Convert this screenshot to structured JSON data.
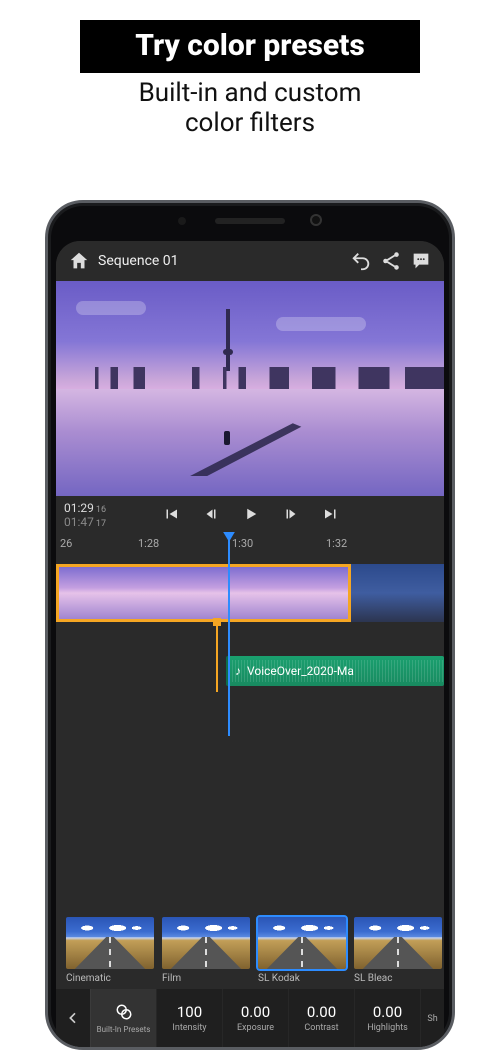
{
  "promo": {
    "title": "Try color presets",
    "subtitle_line1": "Built-in and custom",
    "subtitle_line2": "color filters"
  },
  "topbar": {
    "sequence_name": "Sequence 01"
  },
  "timecode": {
    "in": "01:29",
    "in_frames": "16",
    "out": "01:47",
    "out_frames": "17"
  },
  "ruler": {
    "labels": [
      "26",
      "1:28",
      "1:30",
      "1:32"
    ]
  },
  "audio_clip": {
    "label": "VoiceOver_2020-Ma"
  },
  "presets": [
    {
      "label": "Cinematic",
      "selected": false
    },
    {
      "label": "Film",
      "selected": false
    },
    {
      "label": "SL Kodak",
      "selected": true
    },
    {
      "label": "SL Bleac",
      "selected": false
    }
  ],
  "params": {
    "builtin_label": "Built-In Presets",
    "items": [
      {
        "value": "100",
        "label": "Intensity"
      },
      {
        "value": "0.00",
        "label": "Exposure"
      },
      {
        "value": "0.00",
        "label": "Contrast"
      },
      {
        "value": "0.00",
        "label": "Highlights"
      },
      {
        "value": "",
        "label": "Sh"
      }
    ]
  }
}
